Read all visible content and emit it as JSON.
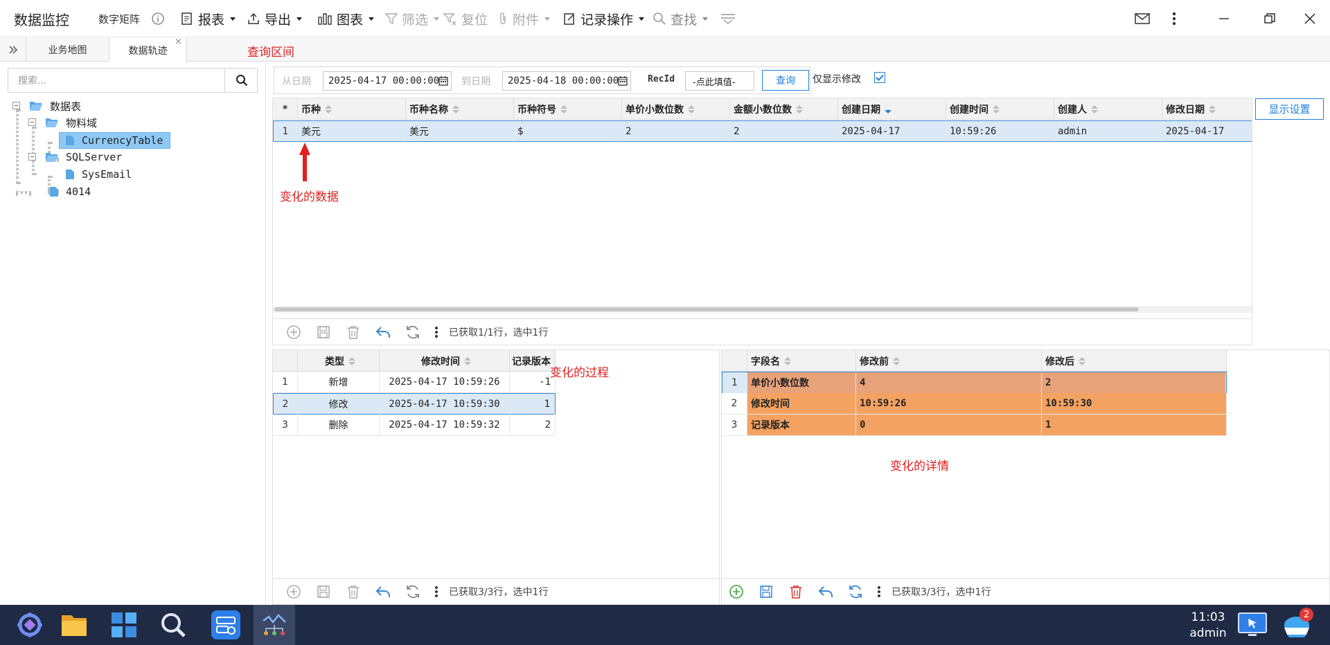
{
  "app": {
    "title": "数据监控",
    "subtitle": "数字矩阵"
  },
  "toolbar": {
    "report": "报表",
    "export": "导出",
    "chart": "图表",
    "filter": "筛选",
    "reset": "复位",
    "attachment": "附件",
    "record_ops": "记录操作",
    "find": "查找"
  },
  "tabs": [
    {
      "label": "业务地图"
    },
    {
      "label": "数据轨迹"
    }
  ],
  "annotations": {
    "query_area": "查询区间",
    "changed_data": "变化的数据",
    "change_process": "变化的过程",
    "change_detail": "变化的详情"
  },
  "search": {
    "placeholder": "搜索..."
  },
  "tree": {
    "root": "数据表",
    "domain": "物料域",
    "currency_table": "CurrencyTable",
    "sqlserver": "SQLServer",
    "sysemail": "SysEmail",
    "n4014": "4014"
  },
  "filter": {
    "from_label": "从日期",
    "from_value": "2025-04-17 00:00:00",
    "to_label": "到日期",
    "to_value": "2025-04-18 00:00:00",
    "recid_label": "RecId",
    "recid_value": "-点此填值-",
    "query_button": "查询",
    "only_modified": "仅显示修改",
    "display_settings": "显示设置"
  },
  "main_grid": {
    "star": "*",
    "columns": [
      "币种",
      "币种名称",
      "币种符号",
      "单价小数位数",
      "金额小数位数",
      "创建日期",
      "创建时间",
      "创建人",
      "修改日期"
    ],
    "rows": [
      {
        "n": "1",
        "cells": [
          "美元",
          "美元",
          "$",
          "2",
          "2",
          "2025-04-17",
          "10:59:26",
          "admin",
          "2025-04-17"
        ]
      }
    ],
    "status": "已获取1/1行，选中1行"
  },
  "history_grid": {
    "columns": [
      "类型",
      "修改时间",
      "记录版本"
    ],
    "rows": [
      {
        "n": "1",
        "cells": [
          "新增",
          "2025-04-17 10:59:26",
          "-1"
        ]
      },
      {
        "n": "2",
        "cells": [
          "修改",
          "2025-04-17 10:59:30",
          "1"
        ]
      },
      {
        "n": "3",
        "cells": [
          "删除",
          "2025-04-17 10:59:32",
          "2"
        ]
      }
    ],
    "status": "已获取3/3行，选中1行"
  },
  "detail_grid": {
    "columns": [
      "字段名",
      "修改前",
      "修改后"
    ],
    "rows": [
      {
        "n": "1",
        "cells": [
          "单价小数位数",
          "4",
          "2"
        ]
      },
      {
        "n": "2",
        "cells": [
          "修改时间",
          "10:59:26",
          "10:59:30"
        ]
      },
      {
        "n": "3",
        "cells": [
          "记录版本",
          "0",
          "1"
        ]
      }
    ],
    "status": "已获取3/3行，选中1行"
  },
  "taskbar": {
    "time": "11:03",
    "user": "admin",
    "badge": "2"
  },
  "colors": {
    "accent": "#1e7fd9",
    "annotation_red": "#e0201f",
    "row_selected": "#dbe9f7",
    "changed_row": "#f4a261",
    "changed_row_selected": "#e8a27a",
    "taskbar": "#1f2a44"
  },
  "icons": [
    "info-icon",
    "report-icon",
    "export-icon",
    "chart-icon",
    "filter-icon",
    "reset-icon",
    "attachment-icon",
    "record-ops-icon",
    "search-icon",
    "collapse-icon",
    "mail-icon",
    "more-icon",
    "minimize-icon",
    "restore-icon",
    "close-icon",
    "calendar-icon",
    "checkbox-icon",
    "add-icon",
    "save-icon",
    "delete-icon",
    "undo-icon",
    "refresh-icon"
  ]
}
